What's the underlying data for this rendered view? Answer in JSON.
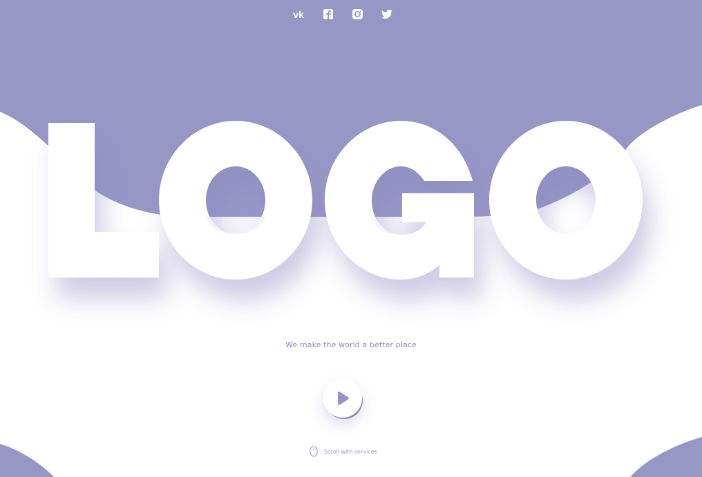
{
  "social": {
    "items": [
      {
        "name": "vk",
        "icon": "vk-icon"
      },
      {
        "name": "facebook",
        "icon": "facebook-icon"
      },
      {
        "name": "instagram",
        "icon": "instagram-icon"
      },
      {
        "name": "twitter",
        "icon": "twitter-icon"
      }
    ]
  },
  "hero": {
    "logo_text": "LOGO",
    "tagline": "We make the world a better place"
  },
  "play_button": {
    "icon": "play-icon"
  },
  "scroll": {
    "icon": "mouse-icon",
    "label": "Scroll with services"
  },
  "colors": {
    "accent": "#9797c6",
    "background": "#ffffff",
    "text_accent": "#8e86c3"
  }
}
